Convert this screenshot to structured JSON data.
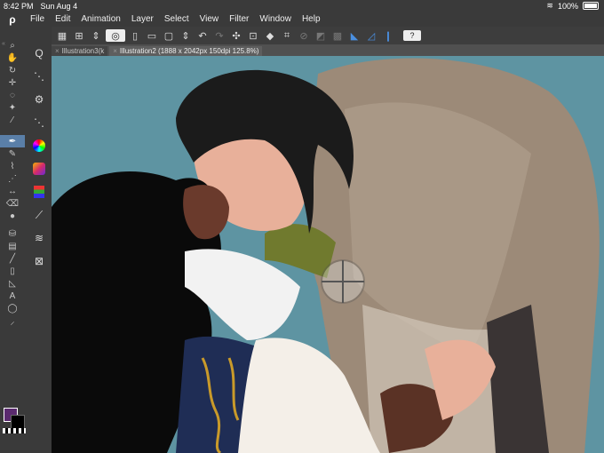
{
  "status": {
    "time": "8:42 PM",
    "date": "Sun Aug 4",
    "battery": "100%",
    "wifi_icon": "wifi-icon"
  },
  "menu": {
    "logo": "ρ",
    "items": [
      "File",
      "Edit",
      "Animation",
      "Layer",
      "Select",
      "View",
      "Filter",
      "Window",
      "Help"
    ]
  },
  "tabs": [
    {
      "label": "Illustration3(k"
    },
    {
      "label": "Illustration2 (1888 x 2042px 150dpi 125.8%)"
    }
  ],
  "colors": {
    "main": "#5a2a6e",
    "sub": "#000000",
    "canvas_bg": "#5e94a2",
    "accent": "#4a8fe0"
  },
  "toolbar_icons": [
    "grid-icon",
    "transform-icon",
    "stepper-icon",
    "swirl-icon",
    "new-file-icon",
    "open-folder-icon",
    "save-icon",
    "stepper-icon",
    "undo-icon",
    "redo-icon",
    "sparkle-icon",
    "frame-icon",
    "fill-icon",
    "crop-icon",
    "disabled-icon",
    "disabled-icon",
    "disabled-icon",
    "ruler-icon",
    "ruler2-icon",
    "pen-pressure-icon",
    "keyboard-icon"
  ],
  "tools_left": [
    "search-icon",
    "hand-icon",
    "rotate-icon",
    "move-icon",
    "lasso-icon",
    "wand-icon",
    "eyedropper-icon",
    "pen-icon",
    "pencil-icon",
    "brush-icon",
    "airbrush-icon",
    "blend-icon",
    "eraser-icon",
    "fill-icon",
    "gradient-icon",
    "shape-icon",
    "frame-icon",
    "ruler-icon",
    "text-icon",
    "balloon-icon",
    "correct-line-icon"
  ],
  "tools_right": [
    "search-icon",
    "node-icon",
    "gear-icon",
    "node2-icon",
    "color-wheel-icon",
    "camera-icon",
    "layers-icon",
    "stroke-icon",
    "stack-icon",
    "navigator-icon"
  ]
}
